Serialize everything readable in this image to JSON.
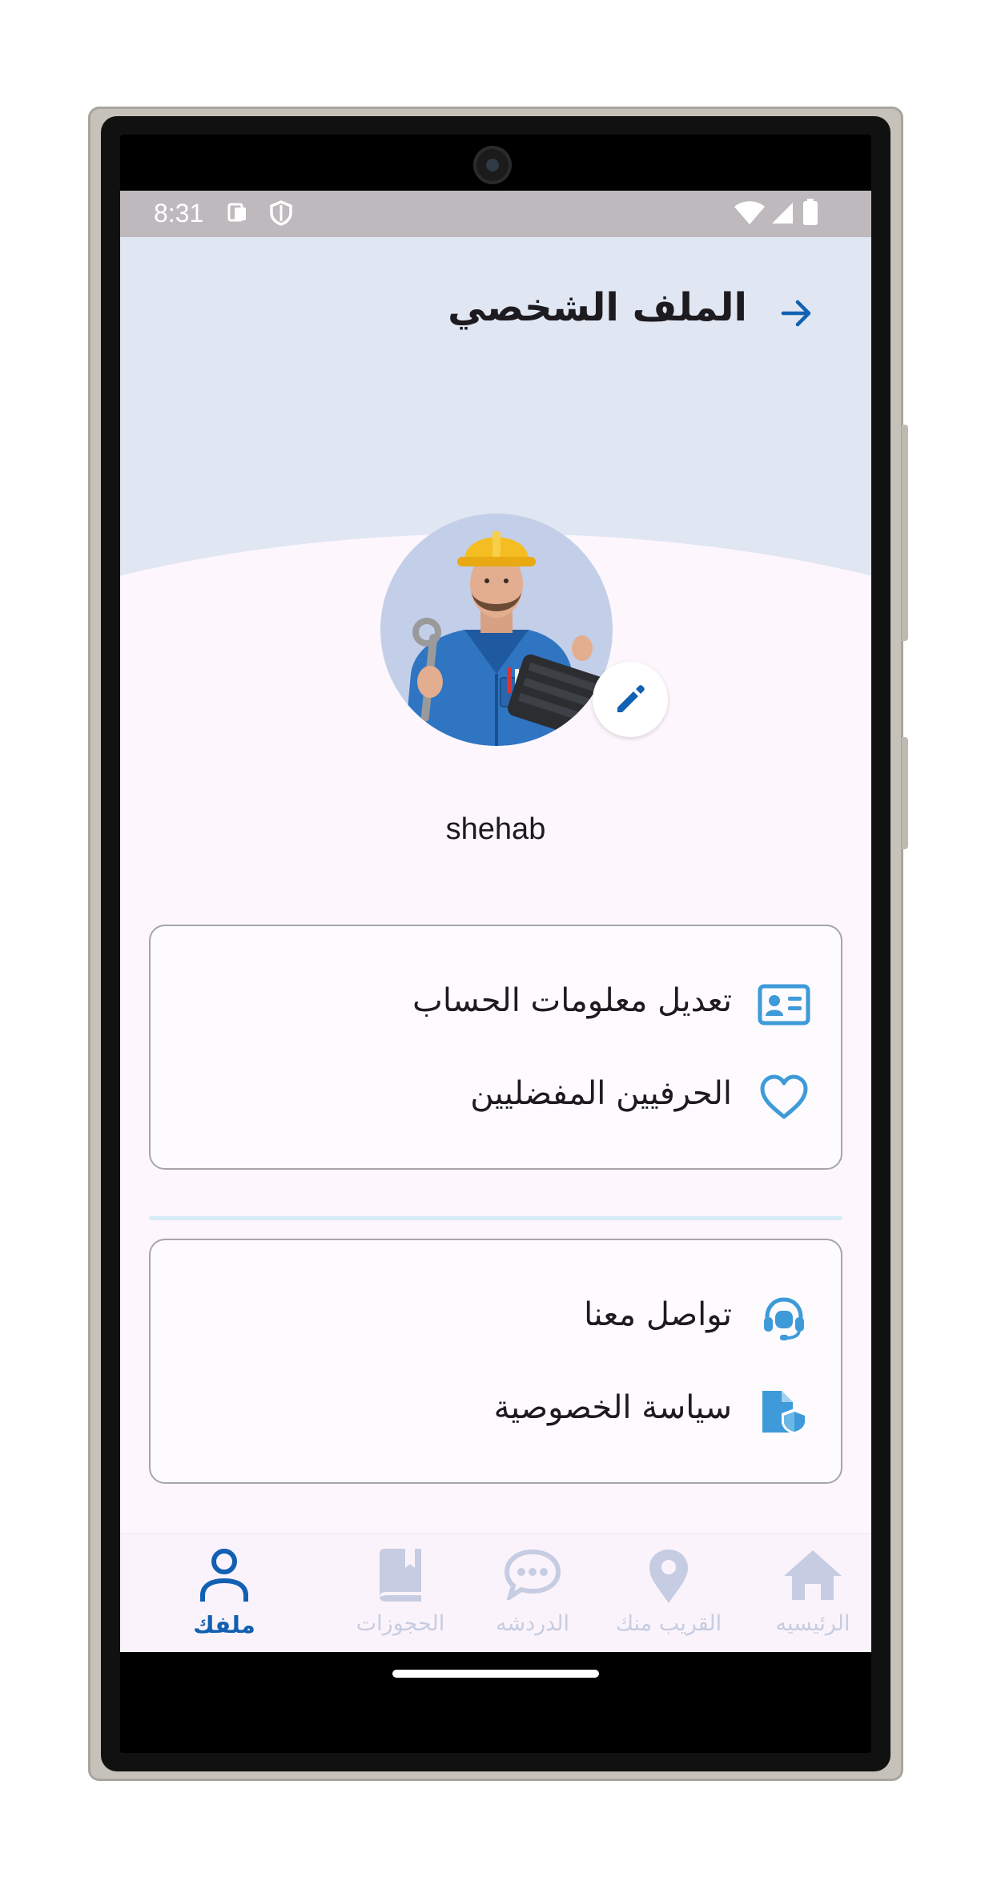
{
  "status_bar": {
    "time": "8:31",
    "left_icons": [
      "sim-card-icon",
      "shield-icon"
    ],
    "right_icons": [
      "wifi-icon",
      "signal-icon",
      "battery-icon"
    ]
  },
  "header": {
    "title": "الملف الشخصي",
    "back_icon": "arrow-right-icon"
  },
  "profile": {
    "avatar": "worker-avatar",
    "edit_icon": "pencil-icon",
    "username": "shehab"
  },
  "colors": {
    "primary": "#1160b2",
    "icon_blue": "#3e9ad8",
    "header_bg": "#e0e6f2",
    "page_bg": "#fdf7fd",
    "inactive_nav": "#c6cde2"
  },
  "account_section": {
    "items": [
      {
        "label": "تعديل معلومات الحساب",
        "icon": "id-card-icon"
      },
      {
        "label": "الحرفيين المفضليين",
        "icon": "heart-icon"
      }
    ]
  },
  "support_section": {
    "items": [
      {
        "label": "تواصل معنا",
        "icon": "headset-icon"
      },
      {
        "label": "سياسة الخصوصية",
        "icon": "privacy-document-icon"
      }
    ]
  },
  "bottom_nav": {
    "items": [
      {
        "label": "الرئيسيه",
        "icon": "home-icon",
        "active": false
      },
      {
        "label": "القريب منك",
        "icon": "location-pin-icon",
        "active": false
      },
      {
        "label": "الدردشه",
        "icon": "chat-bubble-icon",
        "active": false
      },
      {
        "label": "الحجوزات",
        "icon": "bookings-icon",
        "active": false
      },
      {
        "label": "ملفك",
        "icon": "person-icon",
        "active": true
      }
    ]
  }
}
